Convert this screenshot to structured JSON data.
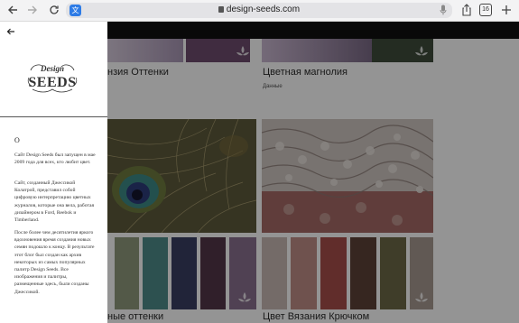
{
  "browser": {
    "url": "design-seeds.com",
    "tabs_count": "16",
    "translate_glyph": "文"
  },
  "cards": {
    "top_left_title": "нзия Оттенки",
    "top_right_title": "Цветная магнолия",
    "top_right_tag": "Данные",
    "bottom_left_title": "ные оттенки",
    "bottom_right_title": "Цвет Вязания Крючком"
  },
  "colors": {
    "top_left_swatches": [
      "#a896b4",
      "#6e4d6e",
      "#cbbbcf"
    ],
    "top_right_swatches": [
      "#7b6a86",
      "#3e4d3c"
    ],
    "peacock_swatches": [
      "#8f9a7c",
      "#4f8c8a",
      "#3a3f62",
      "#533649",
      "#8a7090"
    ],
    "crochet_swatches": [
      "#c9b8b4",
      "#c08d87",
      "#a84f4b",
      "#5e4238",
      "#6d6a48",
      "#a89a92"
    ]
  },
  "panel": {
    "heading": "О",
    "paragraphs": [
      "Сайт Design Seeds был запущен в мае 2009 года для всех, кто любит цвет.",
      "Сайт, созданный Джессикой Колатрой, представил собой цифровую интерпретацию цветных журналов, которые она вела, работая дизайнером в Ford, Reebok и Timberland.",
      "После более чем десятилетия яркого вдохновения время создания новых семян подошло к концу. В результате этот блог был создан как архив некоторых из самых популярных палитр Design Seeds. Все изображения и палитры, размещенные здесь, были созданы Джессикой."
    ]
  }
}
